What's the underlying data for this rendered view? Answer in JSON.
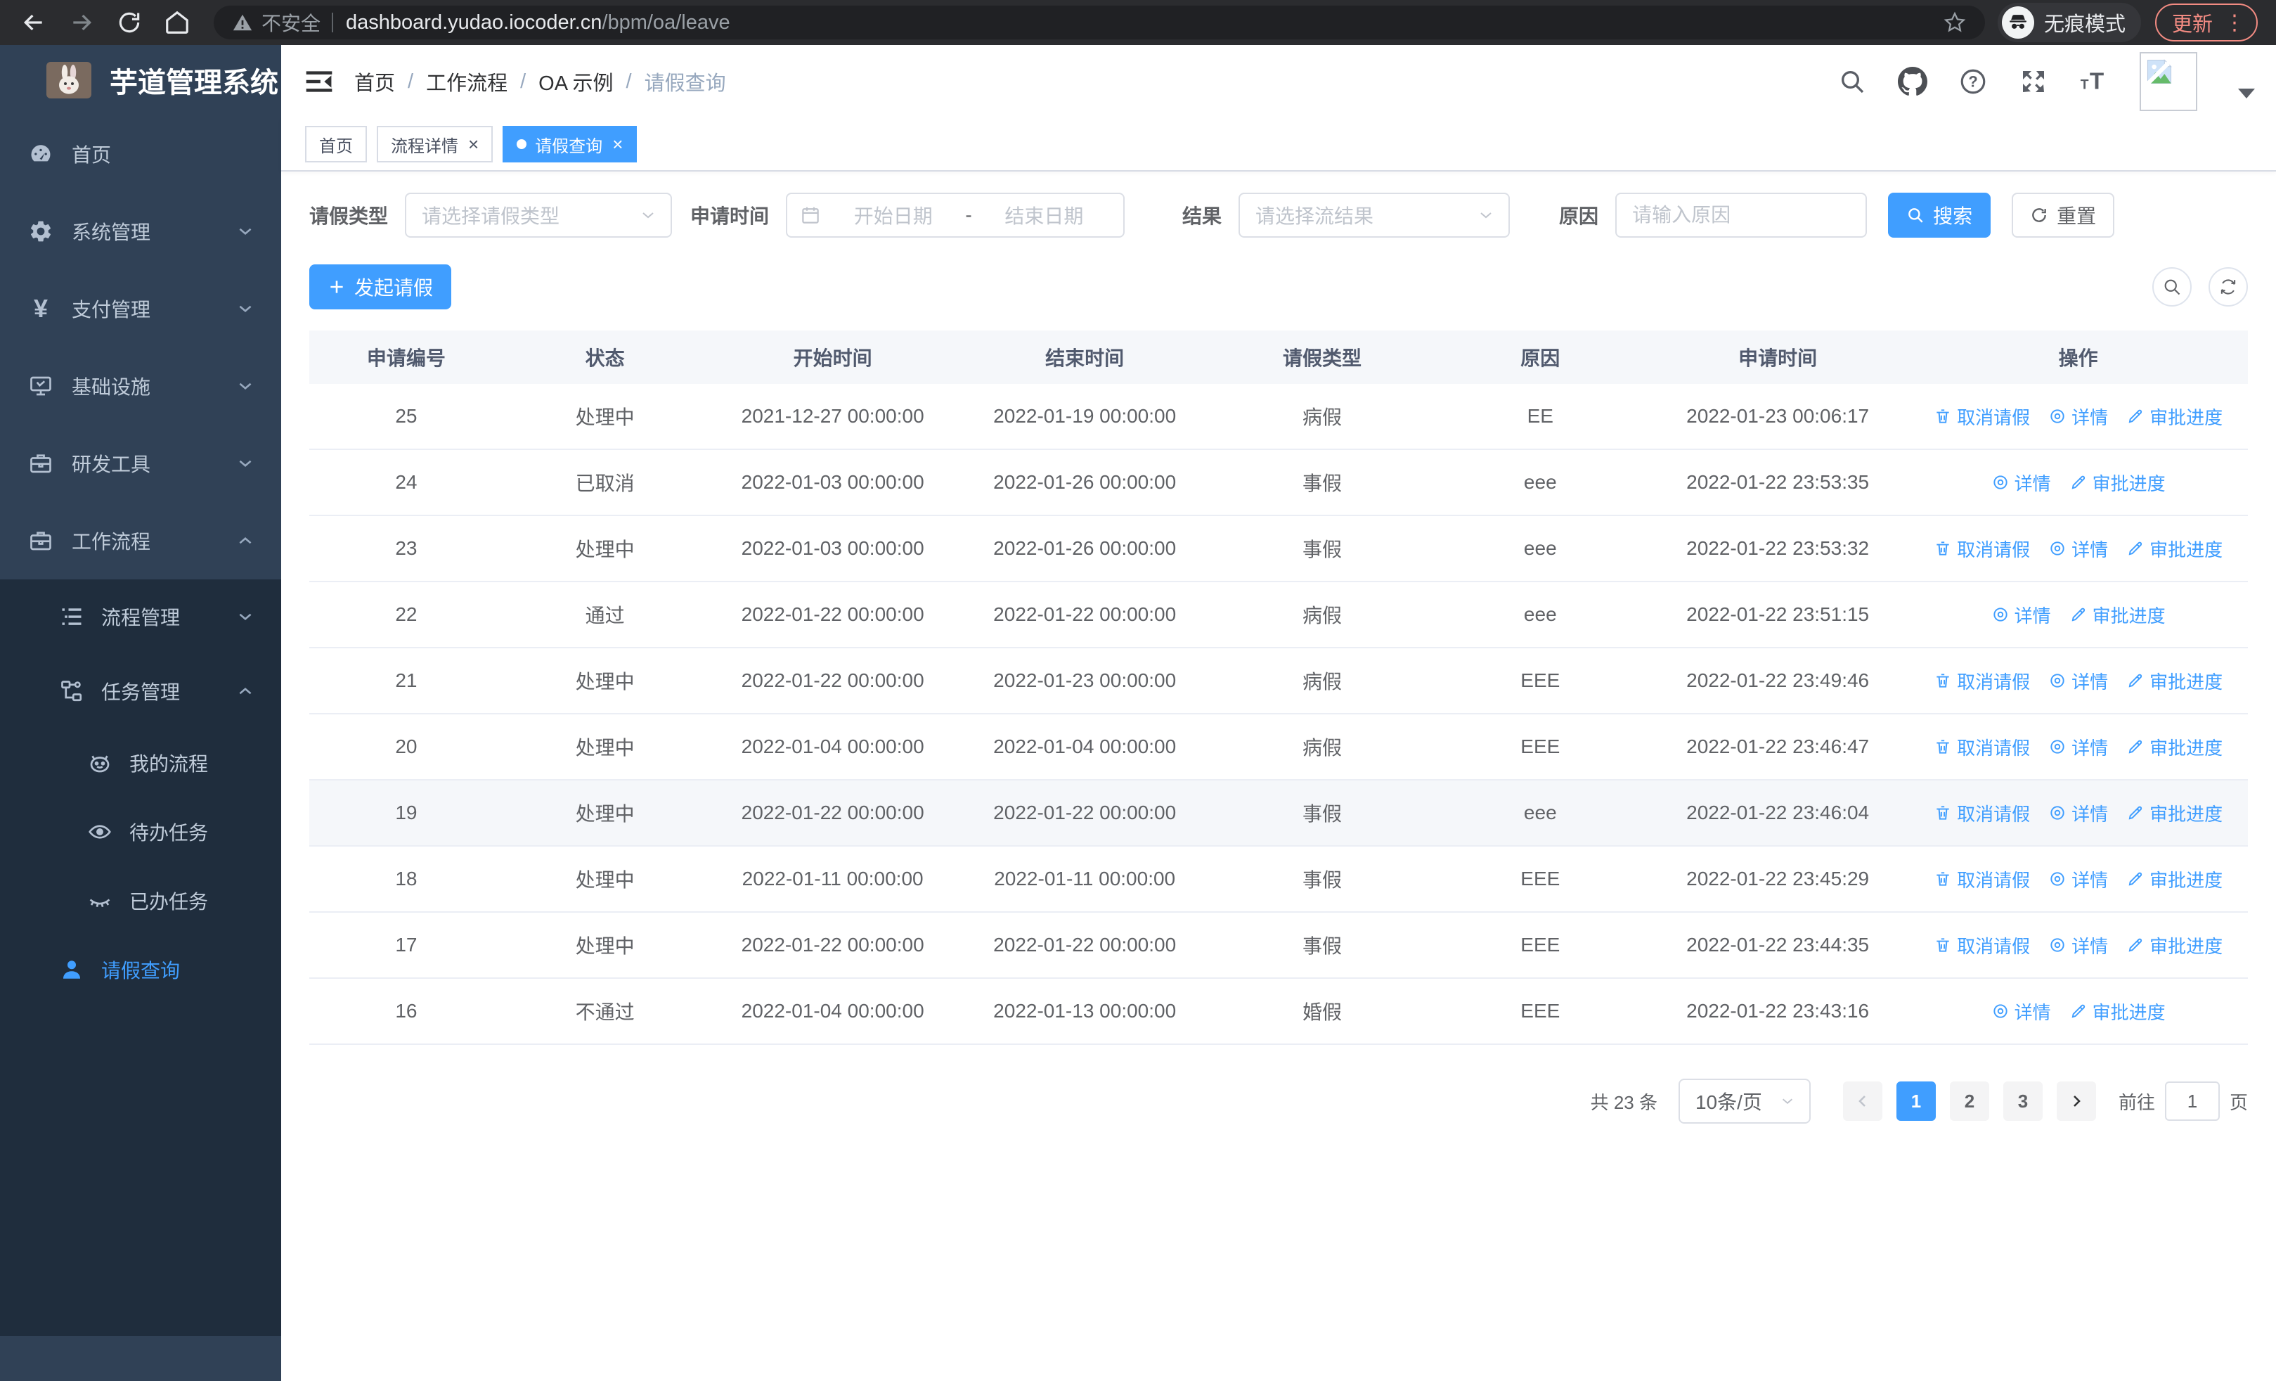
{
  "colors": {
    "accent": "#409eff",
    "sidebar_bg": "#304156",
    "submenu_bg": "#1f2d3d",
    "update_badge": "#f28b82"
  },
  "browser": {
    "security_label": "不安全",
    "url_host": "dashboard.yudao.iocoder.cn",
    "url_path": "/bpm/oa/leave",
    "incognito_label": "无痕模式",
    "update_label": "更新"
  },
  "sidebar": {
    "logo_title": "芋道管理系统",
    "menu": [
      {
        "label": "首页",
        "icon": "dashboard-icon"
      },
      {
        "label": "系统管理",
        "icon": "gear-icon"
      },
      {
        "label": "支付管理",
        "icon": "yen-icon"
      },
      {
        "label": "基础设施",
        "icon": "monitor-icon"
      },
      {
        "label": "研发工具",
        "icon": "toolbox-icon"
      },
      {
        "label": "工作流程",
        "icon": "briefcase-icon"
      }
    ],
    "workflow_children": [
      {
        "label": "流程管理",
        "icon": "tree-list-icon"
      },
      {
        "label": "任务管理",
        "icon": "flow-icon"
      }
    ],
    "task_children": [
      {
        "label": "我的流程",
        "icon": "face-icon"
      },
      {
        "label": "待办任务",
        "icon": "eye-open-icon"
      },
      {
        "label": "已办任务",
        "icon": "eye-closed-icon"
      }
    ],
    "leave_item": {
      "label": "请假查询",
      "icon": "user-icon",
      "active": true
    }
  },
  "header": {
    "breadcrumb": [
      "首页",
      "工作流程",
      "OA 示例",
      "请假查询"
    ],
    "breadcrumb_separator": "/"
  },
  "tabs": [
    {
      "label": "首页",
      "closable": false,
      "active": false
    },
    {
      "label": "流程详情",
      "closable": true,
      "active": false
    },
    {
      "label": "请假查询",
      "closable": true,
      "active": true
    }
  ],
  "filters": {
    "leave_type_label": "请假类型",
    "leave_type_placeholder": "请选择请假类型",
    "apply_time_label": "申请时间",
    "start_date_placeholder": "开始日期",
    "range_separator": "-",
    "end_date_placeholder": "结束日期",
    "result_label": "结果",
    "result_placeholder": "请选择流结果",
    "reason_label": "原因",
    "reason_placeholder": "请输入原因",
    "search_button": "搜索",
    "reset_button": "重置"
  },
  "toolbar": {
    "create_button": "发起请假"
  },
  "table": {
    "columns": [
      "申请编号",
      "状态",
      "开始时间",
      "结束时间",
      "请假类型",
      "原因",
      "申请时间",
      "操作"
    ],
    "actions": {
      "cancel": {
        "label": "取消请假",
        "icon": "trash-icon"
      },
      "detail": {
        "label": "详情",
        "icon": "view-icon"
      },
      "progress": {
        "label": "审批进度",
        "icon": "edit-icon"
      }
    },
    "rows": [
      {
        "id": "25",
        "status": "处理中",
        "start": "2021-12-27 00:00:00",
        "end": "2022-01-19 00:00:00",
        "type": "病假",
        "reason": "EE",
        "applied": "2022-01-23 00:06:17",
        "actions": [
          "cancel",
          "detail",
          "progress"
        ]
      },
      {
        "id": "24",
        "status": "已取消",
        "start": "2022-01-03 00:00:00",
        "end": "2022-01-26 00:00:00",
        "type": "事假",
        "reason": "eee",
        "applied": "2022-01-22 23:53:35",
        "actions": [
          "detail",
          "progress"
        ]
      },
      {
        "id": "23",
        "status": "处理中",
        "start": "2022-01-03 00:00:00",
        "end": "2022-01-26 00:00:00",
        "type": "事假",
        "reason": "eee",
        "applied": "2022-01-22 23:53:32",
        "actions": [
          "cancel",
          "detail",
          "progress"
        ]
      },
      {
        "id": "22",
        "status": "通过",
        "start": "2022-01-22 00:00:00",
        "end": "2022-01-22 00:00:00",
        "type": "病假",
        "reason": "eee",
        "applied": "2022-01-22 23:51:15",
        "actions": [
          "detail",
          "progress"
        ]
      },
      {
        "id": "21",
        "status": "处理中",
        "start": "2022-01-22 00:00:00",
        "end": "2022-01-23 00:00:00",
        "type": "病假",
        "reason": "EEE",
        "applied": "2022-01-22 23:49:46",
        "actions": [
          "cancel",
          "detail",
          "progress"
        ]
      },
      {
        "id": "20",
        "status": "处理中",
        "start": "2022-01-04 00:00:00",
        "end": "2022-01-04 00:00:00",
        "type": "病假",
        "reason": "EEE",
        "applied": "2022-01-22 23:46:47",
        "actions": [
          "cancel",
          "detail",
          "progress"
        ]
      },
      {
        "id": "19",
        "status": "处理中",
        "start": "2022-01-22 00:00:00",
        "end": "2022-01-22 00:00:00",
        "type": "事假",
        "reason": "eee",
        "applied": "2022-01-22 23:46:04",
        "actions": [
          "cancel",
          "detail",
          "progress"
        ],
        "highlighted": true
      },
      {
        "id": "18",
        "status": "处理中",
        "start": "2022-01-11 00:00:00",
        "end": "2022-01-11 00:00:00",
        "type": "事假",
        "reason": "EEE",
        "applied": "2022-01-22 23:45:29",
        "actions": [
          "cancel",
          "detail",
          "progress"
        ]
      },
      {
        "id": "17",
        "status": "处理中",
        "start": "2022-01-22 00:00:00",
        "end": "2022-01-22 00:00:00",
        "type": "事假",
        "reason": "EEE",
        "applied": "2022-01-22 23:44:35",
        "actions": [
          "cancel",
          "detail",
          "progress"
        ]
      },
      {
        "id": "16",
        "status": "不通过",
        "start": "2022-01-04 00:00:00",
        "end": "2022-01-13 00:00:00",
        "type": "婚假",
        "reason": "EEE",
        "applied": "2022-01-22 23:43:16",
        "actions": [
          "detail",
          "progress"
        ]
      }
    ]
  },
  "pagination": {
    "total_text": "共 23 条",
    "page_size": "10条/页",
    "pages": [
      "1",
      "2",
      "3"
    ],
    "active_page": "1",
    "goto_label": "前往",
    "goto_value": "1",
    "goto_suffix": "页"
  }
}
